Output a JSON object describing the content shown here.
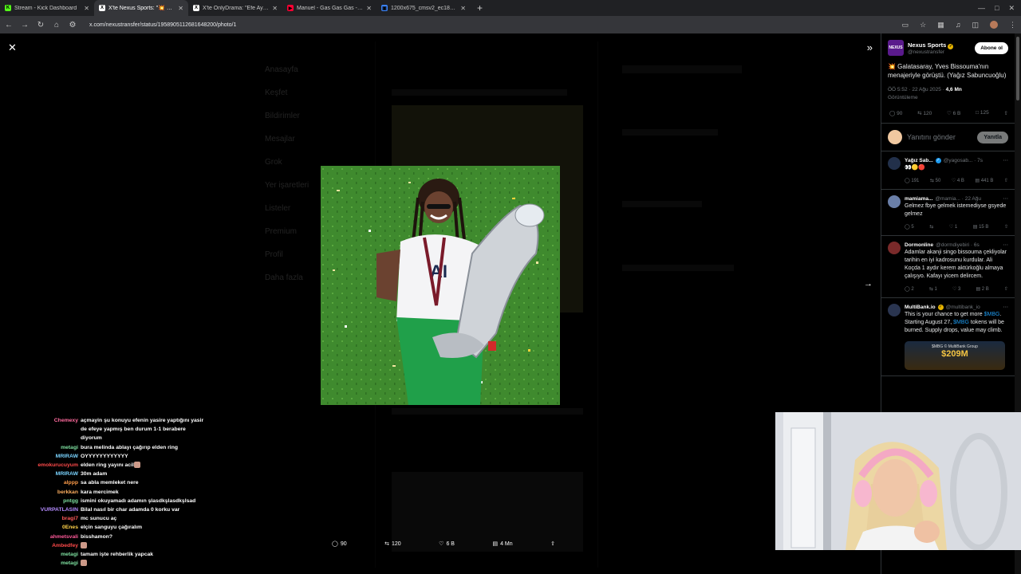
{
  "browser": {
    "tabs": [
      {
        "title": "Stream - Kick Dashboard",
        "favicon_color": "#53fc18",
        "favicon_glyph": "K",
        "active": false
      },
      {
        "title": "X'te Nexus Sports: \"💥 Galatasaray",
        "favicon_color": "#ffffff",
        "favicon_glyph": "X",
        "active": true
      },
      {
        "title": "X'te OnlyDrama: \"Efe Aydal, Bu",
        "favicon_color": "#ffffff",
        "favicon_glyph": "X",
        "active": false
      },
      {
        "title": "Manuel - Gas Gas Gas - YouTube",
        "favicon_color": "#ff0033",
        "favicon_glyph": "▶",
        "active": false
      },
      {
        "title": "1200x675_cmsv2_ec180875-7c",
        "favicon_color": "#3b82f6",
        "favicon_glyph": "▣",
        "active": false
      }
    ],
    "new_tab": "+",
    "url": "x.com/nexustransfer/status/1958905112681648200/photo/1"
  },
  "viewer": {
    "close": "✕",
    "expand": "»",
    "next": "→",
    "actions": {
      "replies": "90",
      "reposts": "120",
      "likes": "6 B",
      "views": "4 Mn"
    }
  },
  "background_nav": [
    "Anasayfa",
    "Keşfet",
    "Bildirimler",
    "Mesajlar",
    "Grok",
    "Yer işaretleri",
    "Listeler",
    "Premium",
    "Profil",
    "Daha fazla"
  ],
  "tweet": {
    "author_name": "Nexus Sports",
    "author_handle": "@nexustransfer",
    "logo_text": "NEXUS",
    "follow_label": "Abone ol",
    "text": "💥 Galatasaray, Yves Bissouma'nın menajeriyle görüştü. (Yağız Sabuncuoğlu)",
    "time": "ÖÖ 5:52 · 22 Ağu 2025 ·",
    "views_count": "4,6 Mn",
    "views_label": "Görüntüleme",
    "stats": {
      "replies": "90",
      "reposts": "120",
      "likes": "6 B",
      "bookmarks": "125"
    },
    "reply_placeholder": "Yanıtını gönder",
    "reply_button": "Yanıtla"
  },
  "replies": [
    {
      "name": "Yağız Sab...",
      "handle": "@yagosab...",
      "time": "· 7s",
      "avatar_color": "#22304a",
      "verified": true,
      "text": "👀🟡🔴",
      "stats": [
        "191",
        "50",
        "4 B",
        "441 B"
      ]
    },
    {
      "name": "mamiama...",
      "handle": "@mamia...",
      "time": "· 22 Ağu",
      "avatar_color": "#6a7fa8",
      "verified": false,
      "text": "Gelmez fbye gelmek istemediyse gsyede gelmez",
      "stats": [
        "5",
        "",
        "1",
        "15 B"
      ]
    },
    {
      "name": "Dormonline",
      "handle": "@dormdiyebiri",
      "time": "· 6s",
      "avatar_color": "#7a2a2a",
      "verified": false,
      "text": "Adamlar akanji singo bissouma çekliyolar tarihin en iyi kadrosunu kurdular. Ali Koçda 1 aydır kerem aktürkoğlu almaya çalışıyo. Kafayı yicem delircem.",
      "stats": [
        "2",
        "1",
        "3",
        "2 B"
      ]
    },
    {
      "name": "MultiBank.io",
      "handle": "@multibank_io",
      "time": "",
      "avatar_color": "#2a3550",
      "verified": true,
      "text_parts": [
        "This is your chance to get more ",
        "$MBG",
        ". Starting August 27, ",
        "$MBG",
        " tokens will be burned. Supply drops, value may climb."
      ],
      "ad_title": "$209M",
      "ad_sub": "$MBG © MultiBank Group"
    }
  ],
  "chat": [
    {
      "user": "Chemexy",
      "color": "#ff6b9e",
      "msg": "açmayin şu konuyu efenin yasire yaptığını yasir de efeye yapmış ben durum 1-1 berabere diyorum"
    },
    {
      "user": "metagi",
      "color": "#7ee0a0",
      "msg": "bura melinda ablayı çağırıp elden ring"
    },
    {
      "user": "MRIRAW",
      "color": "#7ad4ff",
      "msg": "OYYYYYYYYYYYY"
    },
    {
      "user": "emokurucuyum",
      "color": "#ff4a4a",
      "msg": "elden ring yayını acil"
    },
    {
      "user": "MRIRAW",
      "color": "#7ad4ff",
      "msg": "30m adam"
    },
    {
      "user": "alppp",
      "color": "#ff9d4a",
      "msg": "sa abla memleket nere"
    },
    {
      "user": "berkkan",
      "color": "#ffb060",
      "msg": "kara mercimek"
    },
    {
      "user": "pntgg",
      "color": "#7ee0a0",
      "msg": "ismini okuyamadı adamın şlasdkşlasdkşlsad"
    },
    {
      "user": "VURPATLASIN",
      "color": "#b58cff",
      "msg": "Bilal nasıl bir char adamda 0 korku var"
    },
    {
      "user": "bragi7",
      "color": "#ff5a5a",
      "msg": "mc sunucu aç"
    },
    {
      "user": "0Enes",
      "color": "#ffd24a",
      "msg": "elçin sanguyu çağıralım"
    },
    {
      "user": "ahmetsvali",
      "color": "#ff5a9a",
      "msg": "bisshamon?"
    },
    {
      "user": "Ambedfey",
      "color": "#ff4a4a",
      "msg": ""
    },
    {
      "user": "metagi",
      "color": "#7ee0a0",
      "msg": "tamam işte rehberlik yapcak"
    },
    {
      "user": "metagi",
      "color": "#7ee0a0",
      "msg": ""
    }
  ]
}
